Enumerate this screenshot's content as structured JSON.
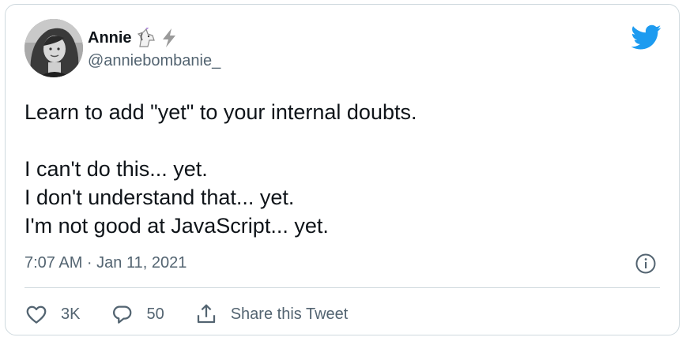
{
  "tweet": {
    "author": {
      "display_name": "Annie",
      "handle": "@anniebombanie_"
    },
    "text_lines": [
      "Learn to add \"yet\" to your internal doubts.",
      "I can't do this... yet.",
      "I don't understand that... yet.",
      "I'm not good at JavaScript... yet."
    ],
    "timestamp": "7:07 AM · Jan 11, 2021",
    "actions": {
      "likes": "3K",
      "replies": "50",
      "share_label": "Share this Tweet"
    }
  },
  "colors": {
    "brand": "#1d9bf0",
    "text_primary": "#0f1419",
    "text_secondary": "#536471",
    "border": "#cfd9de"
  },
  "icons": {
    "brand": "twitter-bird-icon",
    "name_emojis": [
      "unicorn-icon",
      "lightning-icon"
    ],
    "info": "info-icon",
    "like": "heart-icon",
    "reply": "reply-icon",
    "share": "share-icon"
  }
}
